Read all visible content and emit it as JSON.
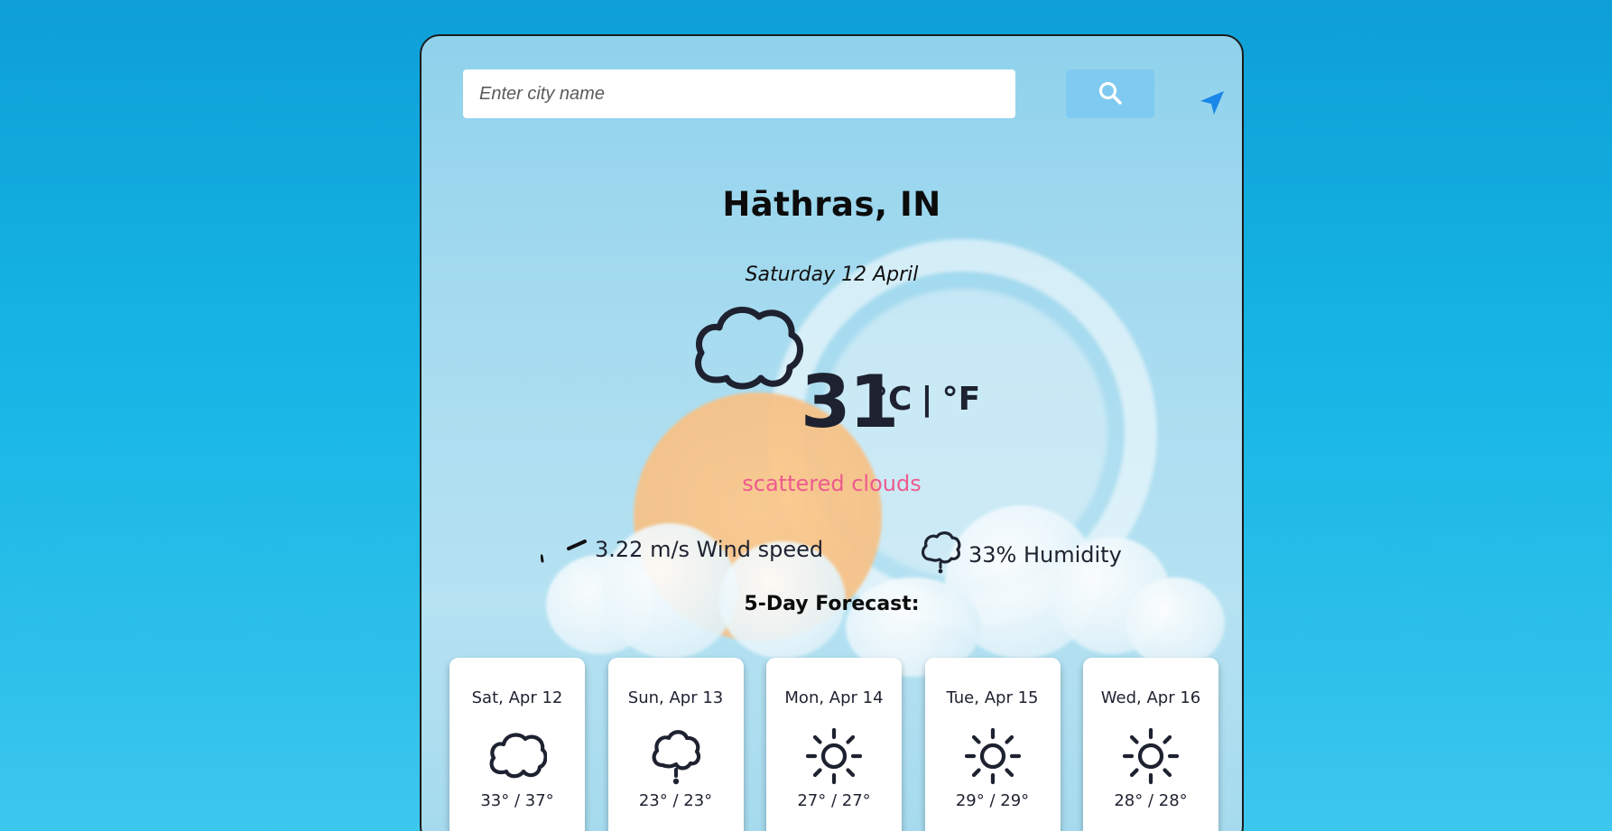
{
  "search": {
    "placeholder": "Enter city name",
    "value": ""
  },
  "icons": {
    "search_button": "search-icon",
    "locate_button": "location-arrow-icon"
  },
  "current": {
    "city": "Hāthras, IN",
    "date": "Saturday 12 April",
    "icon": "cloud-icon",
    "temperature": "31",
    "unit_celsius": "°C",
    "unit_separator": "|",
    "unit_fahrenheit": "°F",
    "description": "scattered clouds",
    "wind_icon": "wind-icon",
    "wind_text": "3.22 m/s Wind speed",
    "humidity_icon": "humidity-icon",
    "humidity_text": "33% Humidity"
  },
  "forecast": {
    "title": "5-Day Forecast:",
    "days": [
      {
        "day": "Sat, Apr 12",
        "icon": "cloud-icon",
        "temp": "33° / 37°"
      },
      {
        "day": "Sun, Apr 13",
        "icon": "rain-icon",
        "temp": "23° / 23°"
      },
      {
        "day": "Mon, Apr 14",
        "icon": "sun-icon",
        "temp": "27° / 27°"
      },
      {
        "day": "Tue, Apr 15",
        "icon": "sun-icon",
        "temp": "29° / 29°"
      },
      {
        "day": "Wed, Apr 16",
        "icon": "sun-icon",
        "temp": "28° / 28°"
      }
    ]
  },
  "colors": {
    "description": "#ee5a8e",
    "search_button": "#7fcaf0",
    "locate_icon": "#1a86e8",
    "text_dark": "#1e2230"
  }
}
